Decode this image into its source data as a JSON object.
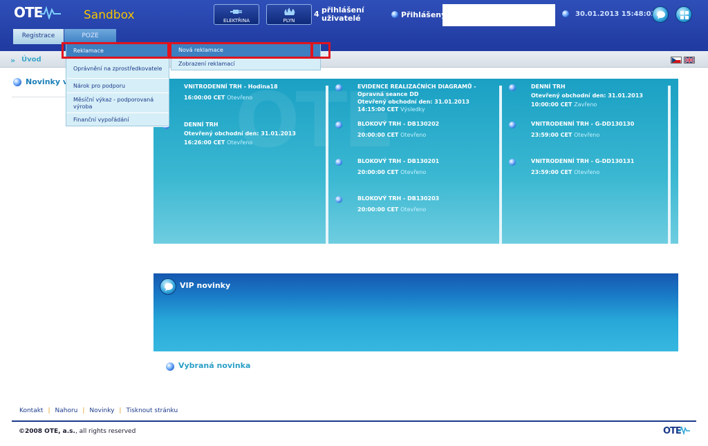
{
  "header": {
    "logo": "OTE",
    "app_name": "Sandbox",
    "buttons": [
      {
        "label": "ELEKTŘINA",
        "icon": "plug-icon"
      },
      {
        "label": "PLYN",
        "icon": "flame-icon"
      }
    ],
    "users_count": "4",
    "users_label_1": "přihlášení",
    "users_label_2": "uživatelé",
    "logged_label": "Přihlášený:",
    "datetime": "30.01.2013 15:48:03",
    "icons": [
      "chat-icon",
      "windows-icon"
    ]
  },
  "menu": {
    "tabs": [
      "Registrace",
      "POZE"
    ],
    "active_tab": "POZE"
  },
  "breadcrumb": {
    "arrow": "»",
    "current": "Úvod"
  },
  "dropdown_level1": [
    {
      "label": "Reklamace"
    },
    {
      "label": "Oprávnění na zprostředkovatele"
    },
    {
      "label": "Nárok pro podporu"
    },
    {
      "label": "Měsíční výkaz - podporovaná výroba"
    },
    {
      "label": "Finanční vypořádání"
    }
  ],
  "dropdown_level2": [
    {
      "label": "Nová reklamace"
    },
    {
      "label": "Zobrazení reklamací"
    }
  ],
  "left_news_title": "Novinky vý",
  "market": {
    "col1": [
      {
        "title": "VNITRODENNÍ TRH - Hodina18",
        "line2": "",
        "time": "16:00:00 CET",
        "status": "Otevřeno"
      },
      {
        "title": "DENNÍ TRH",
        "line2": "Otevřený obchodní den: 31.01.2013",
        "time": "16:26:00 CET",
        "status": "Otevřeno"
      }
    ],
    "col2": [
      {
        "title": "EVIDENCE REALIZAČNÍCH DIAGRAMŮ -",
        "line1b": "Opravná seance DD",
        "line2": "Otevřený obchodní den: 31.01.2013",
        "time": "14:15:00 CET",
        "status": "Výsledky"
      },
      {
        "title": "BLOKOVÝ TRH - DB130202",
        "line2": "",
        "time": "20:00:00 CET",
        "status": "Otevřeno"
      },
      {
        "title": "BLOKOVÝ TRH - DB130201",
        "line2": "",
        "time": "20:00:00 CET",
        "status": "Otevřeno"
      },
      {
        "title": "BLOKOVÝ TRH - DB130203",
        "line2": "",
        "time": "20:00:00 CET",
        "status": "Otevřeno"
      }
    ],
    "col3": [
      {
        "title": "DENNÍ TRH",
        "line2": "Otevřený obchodní den: 31.01.2013",
        "time": "10:00:00 CET",
        "status": "Zavřeno"
      },
      {
        "title": "VNITRODENNÍ TRH - G-DD130130",
        "line2": "",
        "time": "23:59:00 CET",
        "status": "Otevřeno"
      },
      {
        "title": "VNITRODENNÍ TRH - G-DD130131",
        "line2": "",
        "time": "23:59:00 CET",
        "status": "Otevřeno"
      }
    ]
  },
  "vip": {
    "title": "VIP novinky"
  },
  "selected_news": "Vybraná novinka",
  "footer": {
    "links": [
      "Kontakt",
      "Nahoru",
      "Novinky",
      "Tisknout stránku"
    ],
    "separator": "|",
    "copyright_bold": "©2008 OTE, a.s.",
    "copyright_rest": ", all rights reserved",
    "logo": "OTE"
  }
}
